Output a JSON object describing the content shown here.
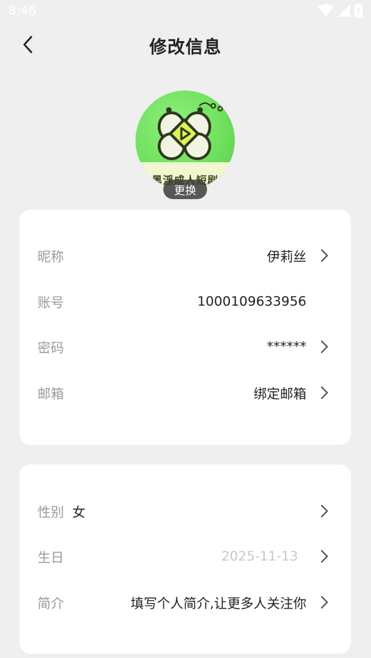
{
  "status_bar": {
    "time": "8:46",
    "icons": [
      "wifi-icon",
      "signal-icon",
      "battery-icon"
    ]
  },
  "header": {
    "title": "修改信息",
    "back_icon": "chevron-left-icon"
  },
  "avatar": {
    "logo_text": "黑淫成人短剧",
    "change_label": "更换"
  },
  "account_card": {
    "rows": [
      {
        "label": "昵称",
        "value": "伊莉丝",
        "has_arrow": true
      },
      {
        "label": "账号",
        "value": "1000109633956",
        "has_arrow": false
      },
      {
        "label": "密码",
        "value": "******",
        "has_arrow": true
      },
      {
        "label": "邮箱",
        "value": "绑定邮箱",
        "has_arrow": true
      }
    ]
  },
  "profile_card": {
    "rows": [
      {
        "label": "性别",
        "value": "女",
        "has_arrow": true
      },
      {
        "label": "生日",
        "value": "2025-11-13",
        "has_arrow": true
      },
      {
        "label": "简介",
        "value": "填写个人简介,让更多人关注你",
        "has_arrow": true
      }
    ]
  },
  "colors": {
    "background": "#efefef",
    "card": "#ffffff",
    "label": "#9a9a9a",
    "value": "#222222",
    "placeholder": "#c8c8c8",
    "avatar_green": "#6fe05d"
  }
}
